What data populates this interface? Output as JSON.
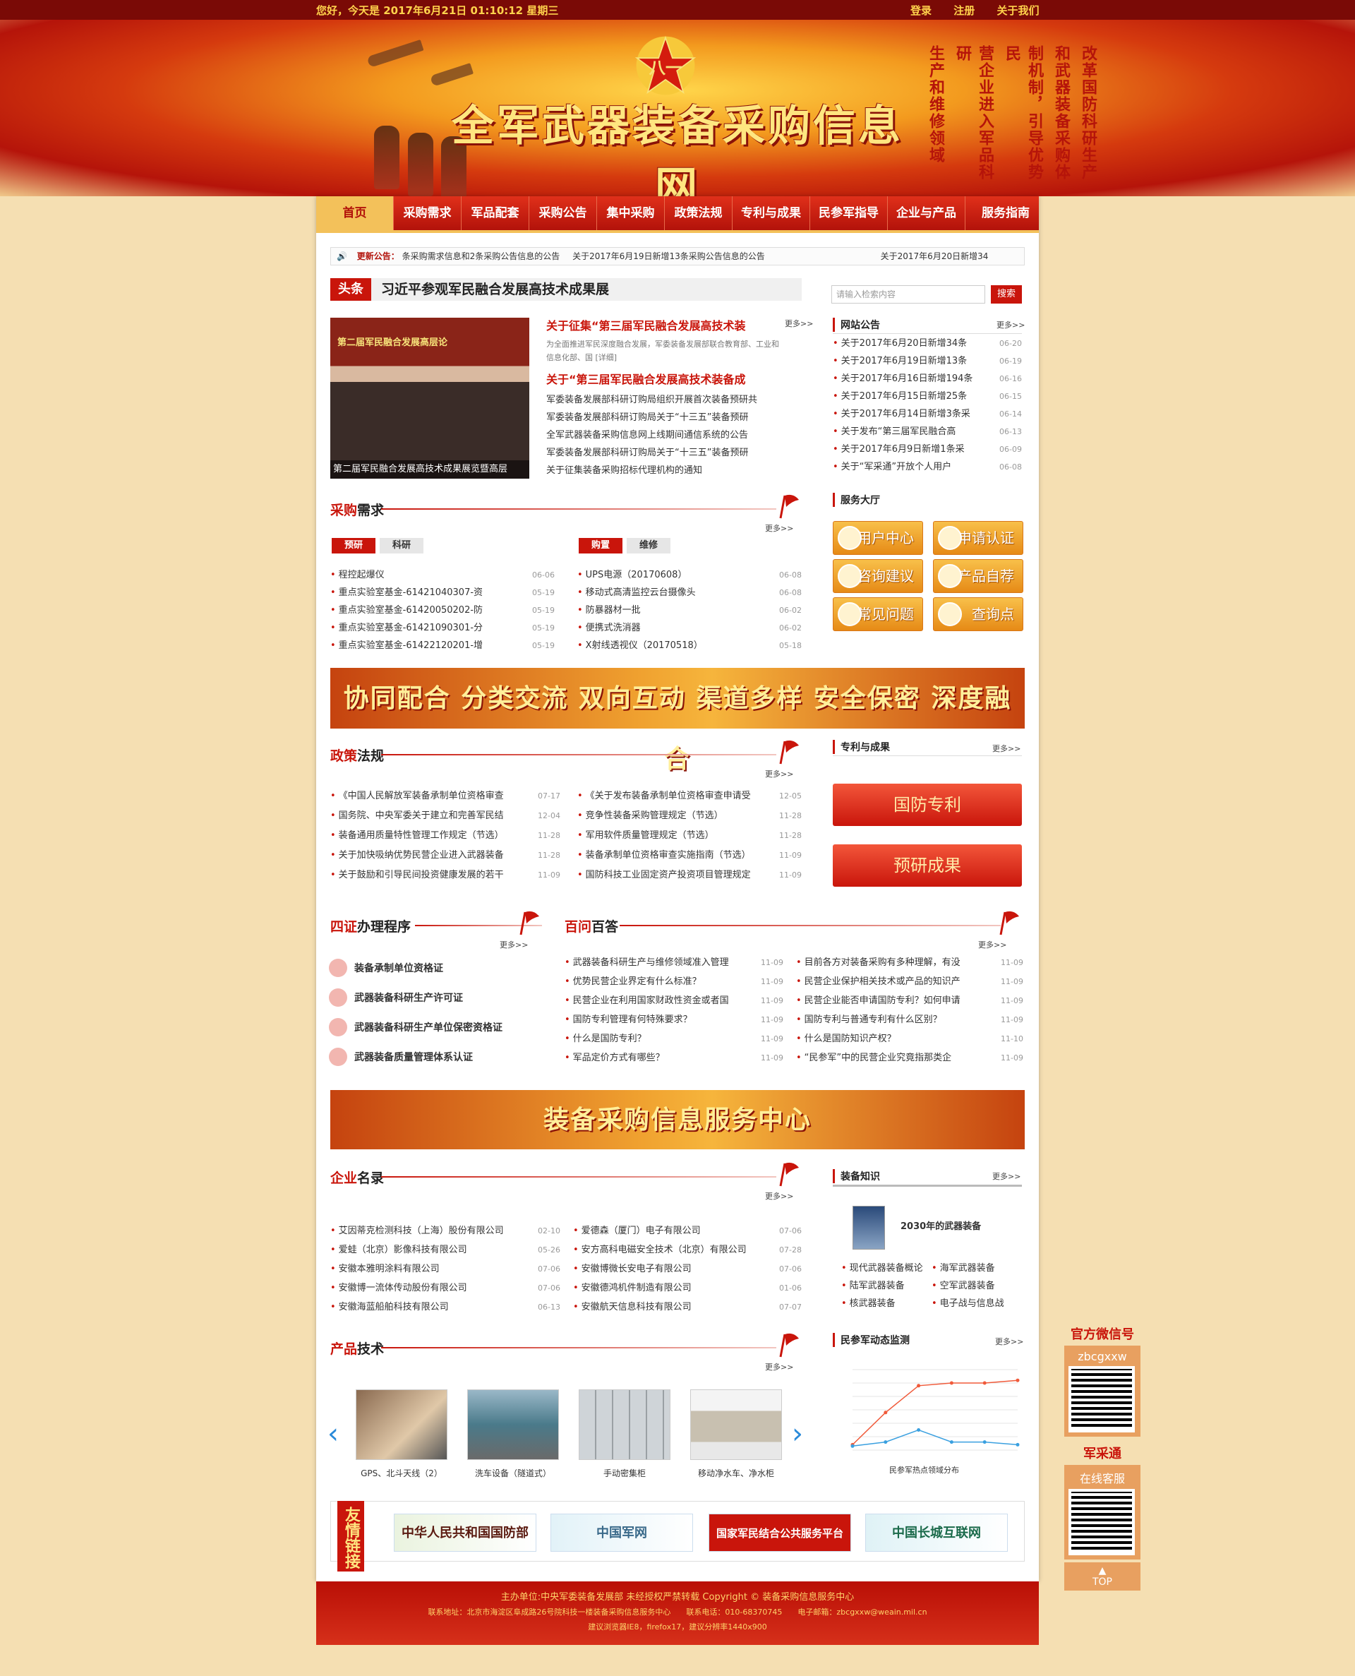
{
  "topbar": {
    "greeting": "您好，今天是 2017年6月21日 01:10:12 星期三",
    "links": [
      "登录",
      "注册",
      "关于我们"
    ]
  },
  "banner": {
    "title": "全军武器装备采购信息网",
    "slogan": [
      "改革国防科研生产",
      "和武器装备采购体",
      "制机制，引导优势民",
      "营企业进入军品科研",
      "生产和维修领域"
    ]
  },
  "nav": {
    "items": [
      "首页",
      "采购需求",
      "军品配套",
      "采购公告",
      "集中采购",
      "政策法规",
      "专利与成果",
      "民参军指导",
      "企业与产品",
      "服务指南"
    ],
    "active": 0
  },
  "notice": {
    "label": "更新公告：",
    "items": [
      "条采购需求信息和2条采购公告信息的公告",
      "关于2017年6月19日新增13条采购公告信息的公告",
      "关于2017年6月20日新增34"
    ]
  },
  "headline": {
    "tag": "头条",
    "title": "习近平参观军民融合发展高技术成果展",
    "photo_caption": "第二届军民融合发展高技术成果展览暨高层",
    "photo_banner": "第二届军民融合发展高层论",
    "lead1": "关于征集“第三届军民融合发展高技术装",
    "summary": "为全面推进军民深度融合发展，军委装备发展部联合教育部、工业和信息化部、国 [详细]",
    "lead2": "关于“第三届军民融合发展高技术装备成",
    "list": [
      "军委装备发展部科研订购局组织开展首次装备预研共",
      "军委装备发展部科研订购局关于“十三五”装备预研",
      "全军武器装备采购信息网上线期间通信系统的公告",
      "军委装备发展部科研订购局关于“十三五”装备预研",
      "关于征集装备采购招标代理机构的通知"
    ],
    "more": "更多>>"
  },
  "search": {
    "placeholder": "请输入检索内容",
    "button": "搜索"
  },
  "site_notice": {
    "title": "网站公告",
    "more": "更多>>",
    "items": [
      [
        "关于2017年6月20日新增34条",
        "06-20"
      ],
      [
        "关于2017年6月19日新增13条",
        "06-19"
      ],
      [
        "关于2017年6月16日新增194条",
        "06-16"
      ],
      [
        "关于2017年6月15日新增25条",
        "06-15"
      ],
      [
        "关于2017年6月14日新增3条采",
        "06-14"
      ],
      [
        "关于发布“第三届军民融合高",
        "06-13"
      ],
      [
        "关于2017年6月9日新增1条采",
        "06-09"
      ],
      [
        "关于“军采通”开放个人用户",
        "06-08"
      ]
    ]
  },
  "services": {
    "title": "服务大厅",
    "items": [
      "用户中心",
      "申请认证",
      "咨询建议",
      "产品自荐",
      "常见问题",
      "查询点"
    ]
  },
  "procurement": {
    "title_a": "采购",
    "title_b": "需求",
    "more": "更多>>",
    "tabs_left": [
      "预研",
      "科研"
    ],
    "tabs_right": [
      "购置",
      "维修"
    ],
    "left": [
      [
        "程控起爆仪",
        "06-06"
      ],
      [
        "重点实验室基金-61421040307-资",
        "05-19"
      ],
      [
        "重点实验室基金-61420050202-防",
        "05-19"
      ],
      [
        "重点实验室基金-61421090301-分",
        "05-19"
      ],
      [
        "重点实验室基金-61422120201-增",
        "05-19"
      ]
    ],
    "right": [
      [
        "UPS电源（20170608）",
        "06-08"
      ],
      [
        "移动式高清监控云台摄像头",
        "06-08"
      ],
      [
        "防暴器材一批",
        "06-02"
      ],
      [
        "便携式洗消器",
        "06-02"
      ],
      [
        "X射线透视仪（20170518）",
        "05-18"
      ]
    ]
  },
  "slogan_banner": "协同配合 分类交流 双向互动 渠道多样 安全保密 深度融合",
  "policy": {
    "title_a": "政策",
    "title_b": "法规",
    "more": "更多>>",
    "left": [
      [
        "《中国人民解放军装备承制单位资格审查",
        "07-17"
      ],
      [
        "国务院、中央军委关于建立和完善军民结",
        "12-04"
      ],
      [
        "装备通用质量特性管理工作规定（节选）",
        "11-28"
      ],
      [
        "关于加快吸纳优势民营企业进入武器装备",
        "11-28"
      ],
      [
        "关于鼓励和引导民间投资健康发展的若干",
        "11-09"
      ]
    ],
    "right": [
      [
        "《关于发布装备承制单位资格审查申请受",
        "12-05"
      ],
      [
        "竞争性装备采购管理规定（节选）",
        "11-28"
      ],
      [
        "军用软件质量管理规定（节选）",
        "11-28"
      ],
      [
        "装备承制单位资格审查实施指南（节选）",
        "11-09"
      ],
      [
        "国防科技工业固定资产投资项目管理规定",
        "11-09"
      ]
    ]
  },
  "patents": {
    "title": "专利与成果",
    "more": "更多>>",
    "buttons": [
      "国防专利",
      "预研成果"
    ]
  },
  "four_cert": {
    "title_a": "四证",
    "title_b": "办理程序",
    "more": "更多>>",
    "items": [
      "装备承制单位资格证",
      "武器装备科研生产许可证",
      "武器装备科研生产单位保密资格证",
      "武器装备质量管理体系认证"
    ]
  },
  "faq": {
    "title_a": "百问",
    "title_b": "百答",
    "more": "更多>>",
    "left": [
      [
        "武器装备科研生产与维修领域准入管理",
        "11-09"
      ],
      [
        "优势民营企业界定有什么标准？",
        "11-09"
      ],
      [
        "民营企业在利用国家财政性资金或者国",
        "11-09"
      ],
      [
        "国防专利管理有何特殊要求？",
        "11-09"
      ],
      [
        "什么是国防专利？",
        "11-09"
      ],
      [
        "军品定价方式有哪些？",
        "11-09"
      ]
    ],
    "right": [
      [
        "目前各方对装备采购有多种理解，有没",
        "11-09"
      ],
      [
        "民营企业保护相关技术或产品的知识产",
        "11-09"
      ],
      [
        "民营企业能否申请国防专利？如何申请",
        "11-09"
      ],
      [
        "国防专利与普通专利有什么区别？",
        "11-09"
      ],
      [
        "什么是国防知识产权？",
        "11-10"
      ],
      [
        "“民参军”中的民营企业究竟指那类企",
        "11-09"
      ]
    ]
  },
  "service_center": "装备采购信息服务中心",
  "companies": {
    "title_a": "企业",
    "title_b": "名录",
    "more": "更多>>",
    "left": [
      [
        "艾因蒂克检测科技（上海）股份有限公司",
        "02-10"
      ],
      [
        "爱蛙（北京）影像科技有限公司",
        "05-26"
      ],
      [
        "安徽本雅明涂料有限公司",
        "07-06"
      ],
      [
        "安徽博一流体传动股份有限公司",
        "07-06"
      ],
      [
        "安徽海蓝船舶科技有限公司",
        "06-13"
      ]
    ],
    "right": [
      [
        "爱德森（厦门）电子有限公司",
        "07-06"
      ],
      [
        "安方高科电磁安全技术（北京）有限公司",
        "07-28"
      ],
      [
        "安徽博微长安电子有限公司",
        "07-06"
      ],
      [
        "安徽德鸿机件制造有限公司",
        "01-06"
      ],
      [
        "安徽航天信息科技有限公司",
        "07-07"
      ]
    ]
  },
  "equip_knowledge": {
    "title": "装备知识",
    "more": "更多>>",
    "book": "2030年的武器装备",
    "items": [
      "现代武器装备概论",
      "海军武器装备",
      "陆军武器装备",
      "空军武器装备",
      "核武器装备",
      "电子战与信息战"
    ]
  },
  "products": {
    "title_a": "产品",
    "title_b": "技术",
    "more": "更多>>",
    "items": [
      "GPS、北斗天线（2）",
      "洗车设备（隧道式）",
      "手动密集柜",
      "移动净水车、净水柜"
    ]
  },
  "monitor": {
    "title": "民参军动态监测",
    "more": "更多>>",
    "caption": "民参军热点领域分布"
  },
  "chart_data": {
    "type": "line",
    "title": "",
    "series": [
      {
        "name": "",
        "values": [
          40,
          280,
          480,
          500,
          500,
          520
        ]
      },
      {
        "name": "",
        "values": [
          30,
          60,
          150,
          60,
          60,
          40
        ]
      }
    ],
    "ylim": [
      0,
      600
    ]
  },
  "friend_links": {
    "label": "友情链接",
    "items": [
      "中华人民共和国国防部",
      "中国军网",
      "国家军民结合公共服务平台",
      "中国长城互联网"
    ]
  },
  "footer": {
    "line1": "主办单位:中央军委装备发展部 未经授权严禁转载 Copyright © 装备采购信息服务中心",
    "line2": "联系地址：北京市海淀区阜成路26号院科技一楼装备采购信息服务中心　　联系电话：010-68370745　　电子邮箱：zbcgxxw@weain.mil.cn",
    "line3": "建议浏览器IE8，firefox17，建议分辨率1440x900"
  },
  "side": {
    "wechat_title": "官方微信号",
    "wechat_id": "zbcgxxw",
    "jct_title": "军采通",
    "jct_sub": "在线客服",
    "top": "TOP"
  }
}
